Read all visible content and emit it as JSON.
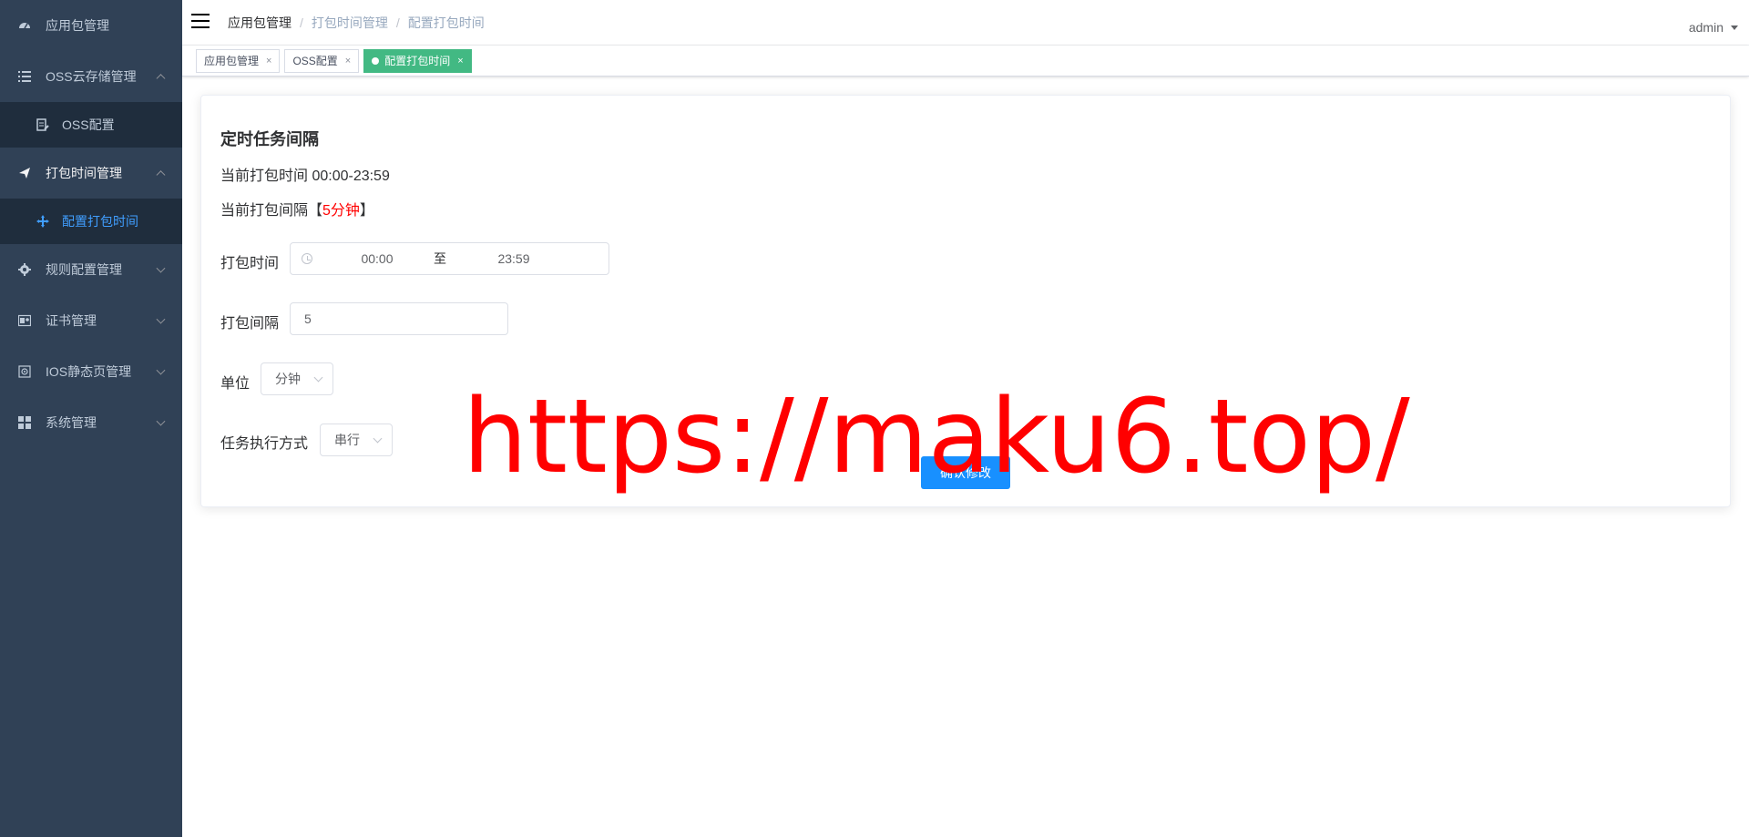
{
  "sidebar": {
    "items": [
      {
        "label": "应用包管理",
        "icon": "dashboard-icon"
      },
      {
        "label": "OSS云存储管理",
        "icon": "list-icon",
        "expanded": true,
        "children": [
          {
            "label": "OSS配置",
            "icon": "document-edit-icon"
          }
        ]
      },
      {
        "label": "打包时间管理",
        "icon": "send-icon",
        "expanded": true,
        "children": [
          {
            "label": "配置打包时间",
            "icon": "move-cross-icon",
            "active": true
          }
        ]
      },
      {
        "label": "规则配置管理",
        "icon": "gear-icon"
      },
      {
        "label": "证书管理",
        "icon": "certificate-icon"
      },
      {
        "label": "IOS静态页管理",
        "icon": "page-frame-icon"
      },
      {
        "label": "系统管理",
        "icon": "grid-icon"
      }
    ]
  },
  "navbar": {
    "breadcrumb": [
      "应用包管理",
      "打包时间管理",
      "配置打包时间"
    ],
    "user": "admin"
  },
  "tags": [
    {
      "label": "应用包管理",
      "active": false
    },
    {
      "label": "OSS配置",
      "active": false
    },
    {
      "label": "配置打包时间",
      "active": true
    }
  ],
  "card": {
    "title": "定时任务间隔",
    "current_time": "当前打包时间 00:00-23:59",
    "current_interval_prefix": "当前打包间隔【",
    "current_interval_value": "5分钟",
    "current_interval_suffix": "】",
    "form": {
      "time_label": "打包时间",
      "time_start": "00:00",
      "time_sep": "至",
      "time_end": "23:59",
      "interval_label": "打包间隔",
      "interval_value": "5",
      "unit_label": "单位",
      "unit_value": "分钟",
      "mode_label": "任务执行方式",
      "mode_value": "串行",
      "confirm": "确认修改"
    }
  },
  "watermark": "https://maku6.top/",
  "colors": {
    "sidebar_bg": "#304156",
    "submenu_bg": "#1f2d3d",
    "active_link": "#409eff",
    "active_tag": "#42b983",
    "primary_button": "#1890ff",
    "watermark": "#ff0000"
  }
}
